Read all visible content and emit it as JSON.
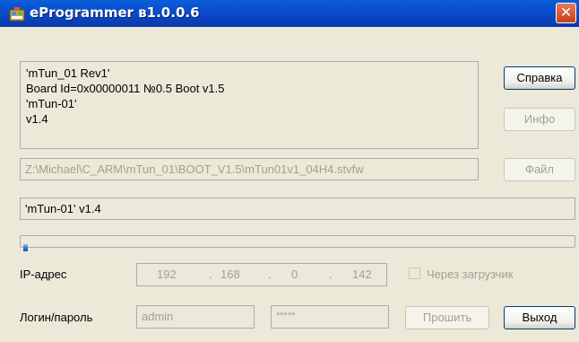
{
  "window": {
    "title": "eProgrammer в1.0.0.6",
    "close_label": "✕"
  },
  "info": {
    "lines": [
      "'mTun_01 Rev1'",
      "Board Id=0x00000011 №0.5 Boot v1.5",
      "'mTun-01'",
      "v1.4"
    ]
  },
  "buttons": {
    "help": "Справка",
    "info": "Инфо",
    "file": "Файл",
    "flash": "Прошить",
    "exit": "Выход"
  },
  "file_path": "Z:\\Michael\\C_ARM\\mTun_01\\BOOT_V1.5\\mTun01v1_04H4.stvfw",
  "firmware_info": "'mTun-01' v1.4",
  "progress": {
    "fraction": 0.016
  },
  "ip": {
    "label": "IP-адрес",
    "octets": [
      "192",
      "168",
      "0",
      "142"
    ],
    "separators": [
      ".",
      ".",
      "."
    ]
  },
  "bootloader_checkbox": {
    "label": "Через загрузчик",
    "checked": false
  },
  "login": {
    "label": "Логин/пароль",
    "username": "admin",
    "password": "*****"
  }
}
